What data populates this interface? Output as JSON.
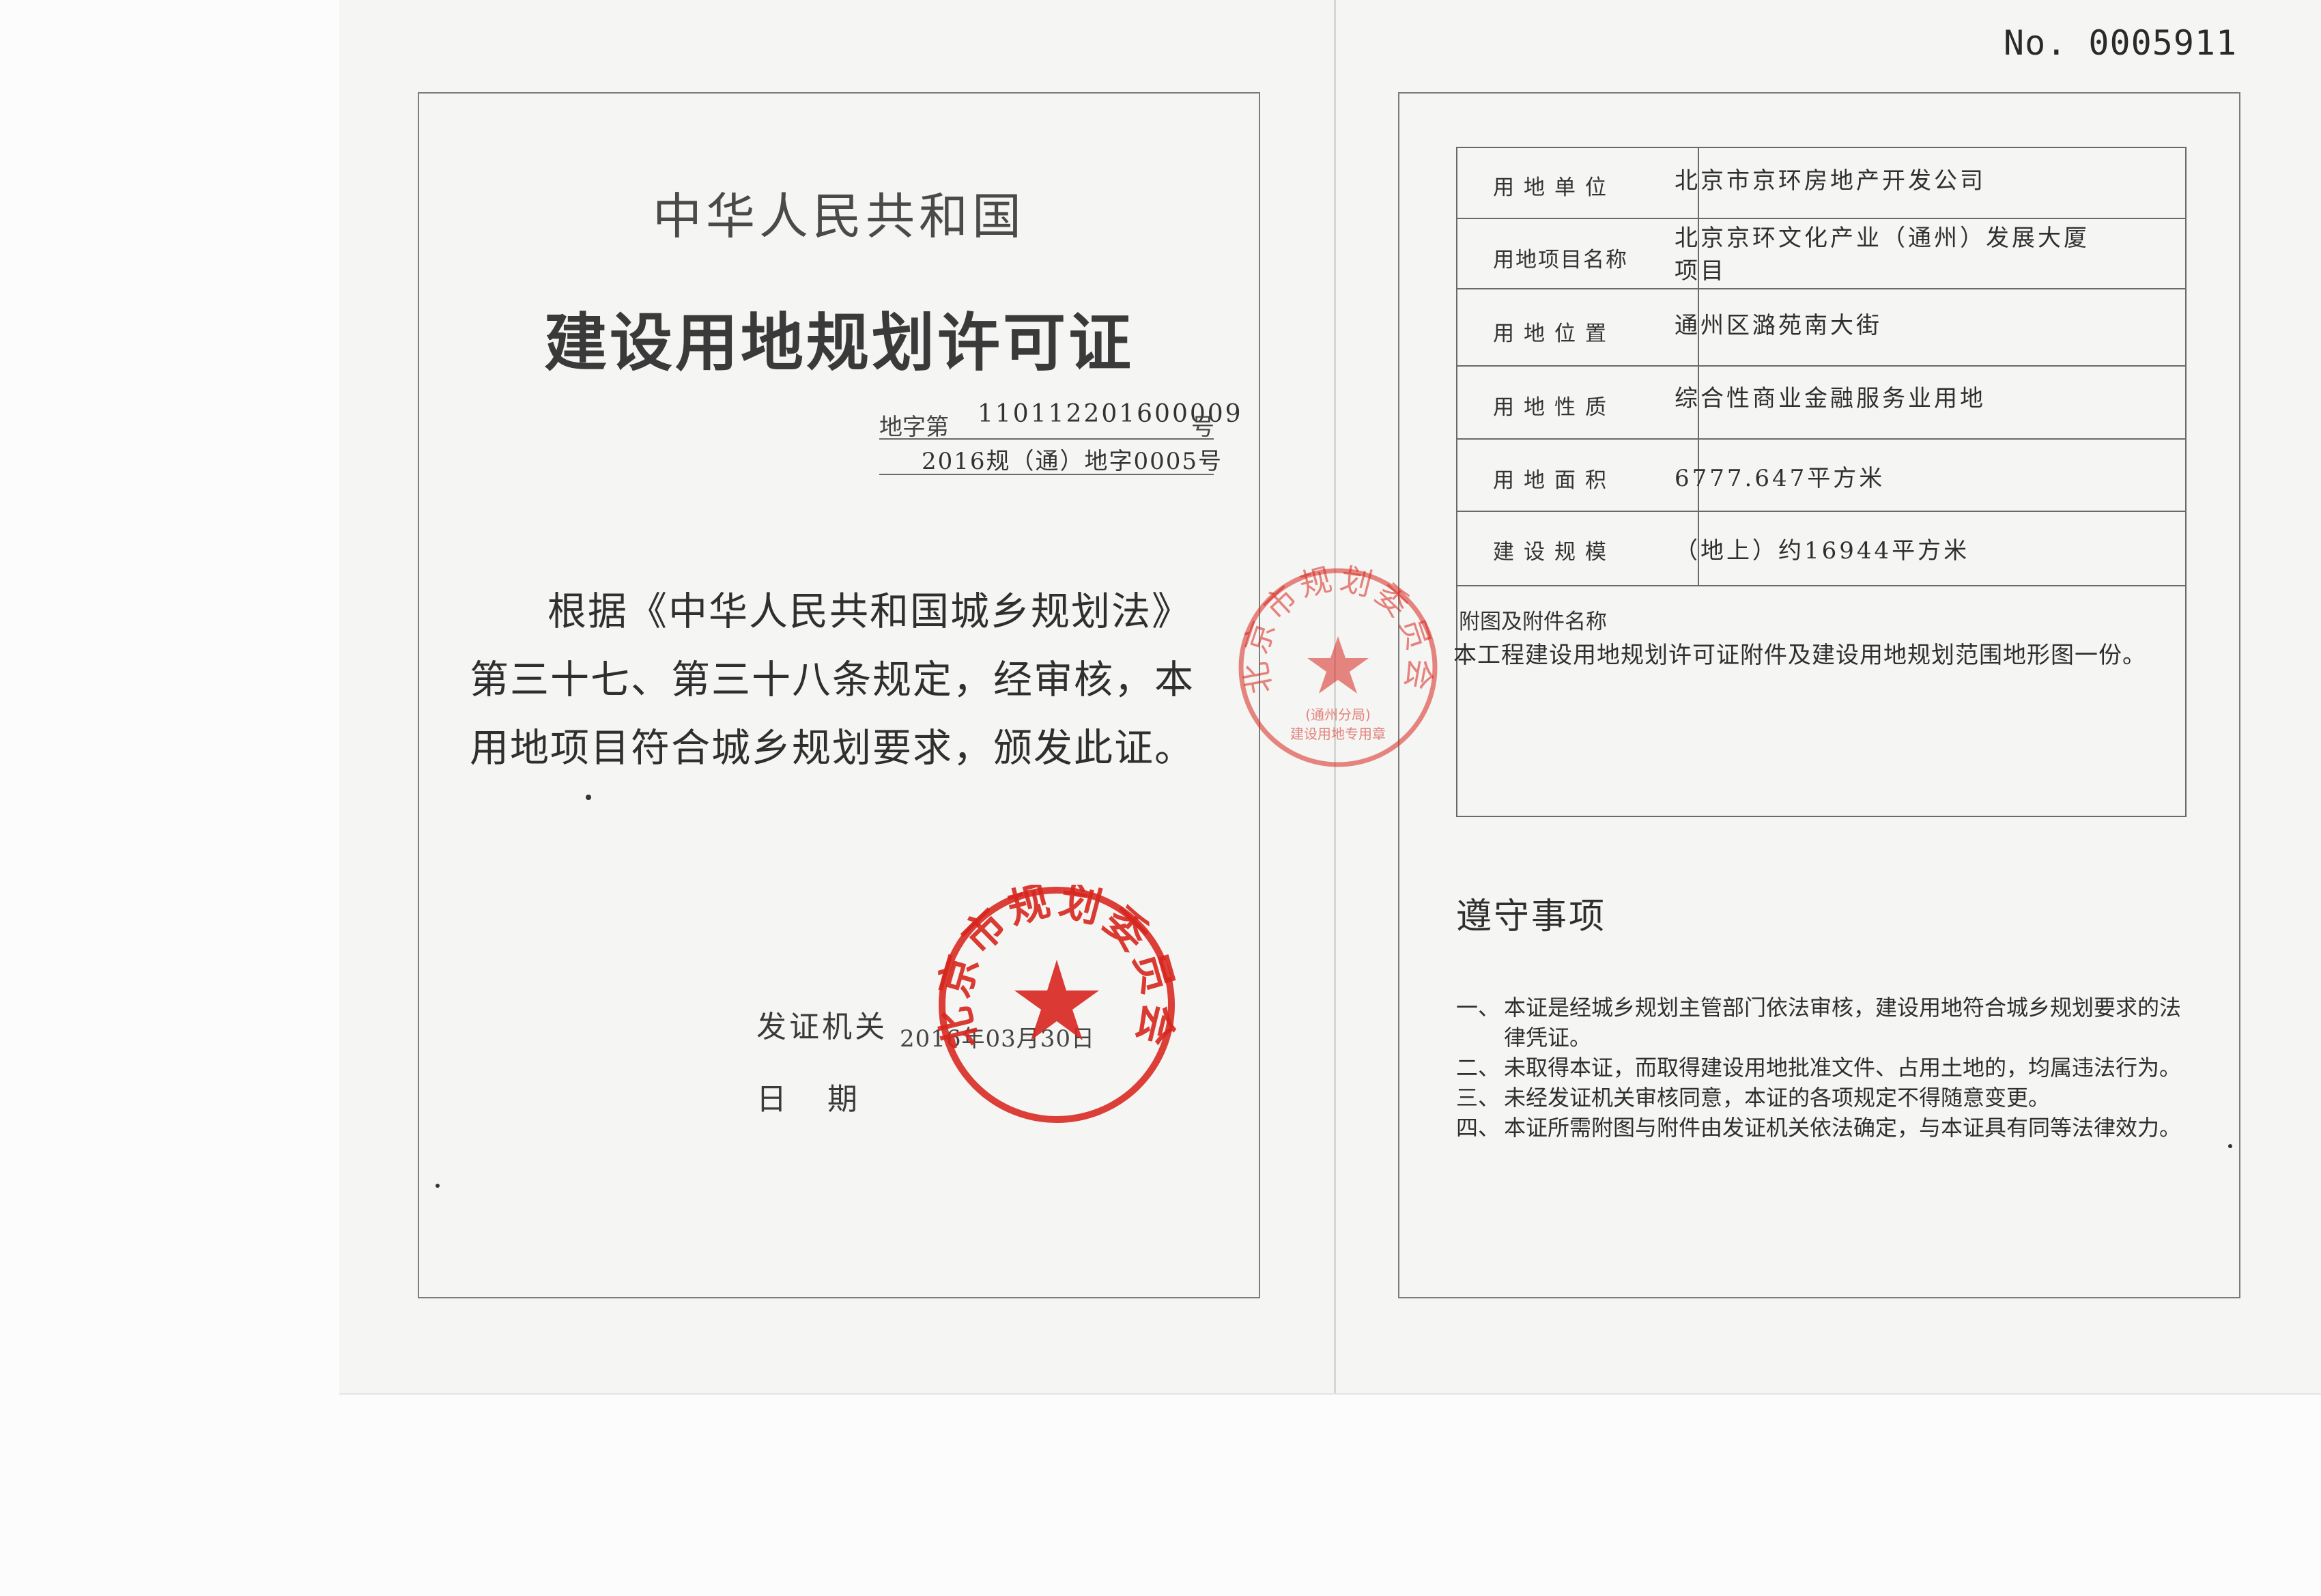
{
  "serial_number": "No. 0005911",
  "cover": {
    "country": "中华人民共和国",
    "title": "建设用地规划许可证",
    "number_prefix": "地字第",
    "number_value": "110112201600009",
    "number_suffix": "号",
    "number_secondary": "2016规（通）地字0005号",
    "body": "根据《中华人民共和国城乡规划法》第三十七、第三十八条规定，经审核，本用地项目符合城乡规划要求，颁发此证。",
    "issuer_label": "发证机关",
    "date_label": "日期",
    "date_value": "2016年03月30日"
  },
  "seals": {
    "main_text": "北京市规划委员会",
    "side_sub_text": "(通州分局)",
    "side_bottom_text": "建设用地专用章",
    "color": "#d7261e"
  },
  "info_rows": [
    {
      "label": "用地单位",
      "value": "北京市京环房地产开发公司"
    },
    {
      "label": "用地项目名称",
      "value": "北京京环文化产业（通州）发展大厦项目"
    },
    {
      "label": "用地位置",
      "value": "通州区潞苑南大街"
    },
    {
      "label": "用地性质",
      "value": "综合性商业金融服务业用地"
    },
    {
      "label": "用地面积",
      "value": "6777.647平方米"
    },
    {
      "label": "建设规模",
      "value": "（地上）约16944平方米"
    }
  ],
  "attachments": {
    "label": "附图及附件名称",
    "text": "本工程建设用地规划许可证附件及建设用地规划范围地形图一份。"
  },
  "notes": {
    "title": "遵守事项",
    "items": [
      {
        "num": "一、",
        "text": "本证是经城乡规划主管部门依法审核，建设用地符合城乡规划要求的法律凭证。"
      },
      {
        "num": "二、",
        "text": "未取得本证，而取得建设用地批准文件、占用土地的，均属违法行为。"
      },
      {
        "num": "三、",
        "text": "未经发证机关审核同意，本证的各项规定不得随意变更。"
      },
      {
        "num": "四、",
        "text": "本证所需附图与附件由发证机关依法确定，与本证具有同等法律效力。"
      }
    ]
  }
}
